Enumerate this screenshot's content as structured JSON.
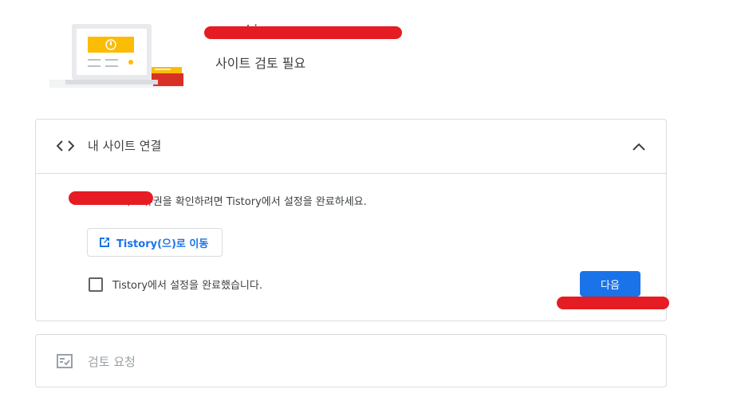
{
  "header": {
    "site_name_visible": "/j g",
    "status": "사이트 검토 필요"
  },
  "connect_card": {
    "title": "내 사이트 연결",
    "instruction": "com의 소유권을 확인하려면 Tistory에서 설정을 완료하세요.",
    "goto_button_label": "Tistory(으)로 이동",
    "confirm_checkbox_label": "Tistory에서 설정을 완료했습니다.",
    "confirm_checked": false,
    "next_button_label": "다음"
  },
  "review_card": {
    "title": "검토 요청"
  },
  "colors": {
    "accent": "#1a73e8",
    "border": "#dadce0",
    "text": "#3c4043",
    "disabled_text": "#9aa0a6",
    "redaction": "#e51c23"
  },
  "icons": {
    "code": "code-icon",
    "collapse": "chevron-up-icon",
    "external": "open-in-new-icon",
    "review": "review-list-icon"
  }
}
